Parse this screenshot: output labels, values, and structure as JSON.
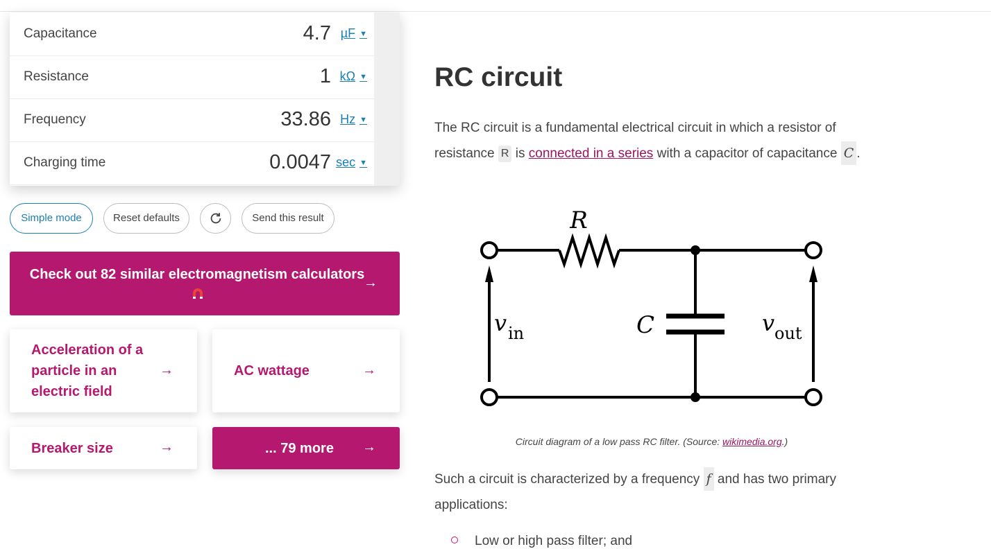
{
  "calculator": {
    "rows": [
      {
        "label": "Capacitance",
        "value": "4.7",
        "unit": "µF"
      },
      {
        "label": "Resistance",
        "value": "1",
        "unit": "kΩ"
      },
      {
        "label": "Frequency",
        "value": "33.86",
        "unit": "Hz"
      },
      {
        "label": "Charging time",
        "value": "0.0047",
        "unit": "sec"
      }
    ],
    "caret": "▼"
  },
  "buttons": {
    "simple_mode": "Simple mode",
    "reset_defaults": "Reset defaults",
    "reload_icon": "↻",
    "send_result": "Send this result"
  },
  "banner": {
    "text": "Check out 82 similar electromagnetism calculators",
    "icon": "magnet-icon",
    "arrow": "→"
  },
  "related": [
    {
      "label": "Acceleration of a particle in an electric field"
    },
    {
      "label": "AC wattage"
    },
    {
      "label": "Breaker size"
    },
    {
      "label": "... 79 more"
    }
  ],
  "article": {
    "title": "RC circuit",
    "intro_a": "The RC circuit is a fundamental electrical circuit in which a resistor of resistance",
    "intro_r": "R",
    "intro_b": "is",
    "intro_link": "connected in a series",
    "intro_c": "with a capacitor of capacitance",
    "intro_cap": "C",
    "intro_end": ".",
    "diagram": {
      "label_r": "R",
      "label_c": "C",
      "label_vin_v": "v",
      "label_vin_sub": "in",
      "label_vout_v": "v",
      "label_vout_sub": "out"
    },
    "caption_text": "Circuit diagram of a low pass RC filter. (Source: ",
    "caption_link": "wikimedia.org",
    "caption_end": ".)",
    "para2_a": "Such a circuit is characterized by a frequency",
    "para2_f": "f",
    "para2_b": "and has two primary applications:",
    "list_item_1": "Low or high pass filter; and"
  }
}
